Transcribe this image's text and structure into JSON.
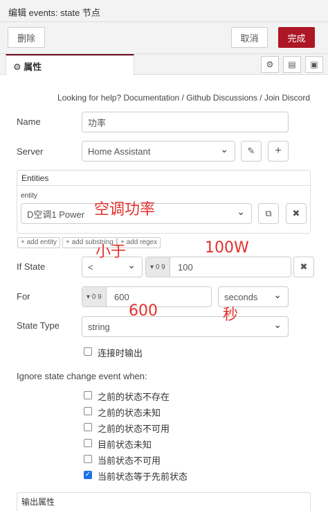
{
  "header": {
    "title": "编辑 events: state 节点"
  },
  "toolbar": {
    "delete_label": "删除",
    "cancel_label": "取消",
    "done_label": "完成"
  },
  "tabs": {
    "properties_label": "属性"
  },
  "help": {
    "lead": "Looking for help?",
    "docs": "Documentation",
    "sep1": "/",
    "github": "Github Discussions",
    "sep2": "/",
    "discord": "Join Discord"
  },
  "form": {
    "name_label": "Name",
    "name_value": "功率",
    "server_label": "Server",
    "server_value": "Home Assistant",
    "entities_title": "Entities",
    "entity_label": "entity",
    "entity_value": "D空调1 Power",
    "add_entity": "+ add entity",
    "add_substring": "+ add substring",
    "add_regex": "+ add regex",
    "if_state_label": "If State",
    "if_state_op": "<",
    "if_state_type": "0 9",
    "if_state_value": "100",
    "for_label": "For",
    "for_type": "0 9",
    "for_value": "600",
    "for_unit": "seconds",
    "state_type_label": "State Type",
    "state_type_value": "string",
    "output_on_connect": "连接时输出",
    "ignore_title": "Ignore state change event when:",
    "ignore_options": [
      {
        "label": "之前的状态不存在",
        "checked": false
      },
      {
        "label": "之前的状态未知",
        "checked": false
      },
      {
        "label": "之前的状态不可用",
        "checked": false
      },
      {
        "label": "目前状态未知",
        "checked": false
      },
      {
        "label": "当前状态不可用",
        "checked": false
      },
      {
        "label": "当前状态等于先前状态",
        "checked": true
      }
    ],
    "output_props_title": "输出属性"
  },
  "annotations": {
    "entity_note": "空调功率",
    "lt_note": "小于",
    "value_note": "100W",
    "for_note": "600",
    "unit_note": "秒"
  },
  "colors": {
    "accent": "#ad1625",
    "annotation": "#e3312c",
    "checkbox": "#1a73e8"
  }
}
